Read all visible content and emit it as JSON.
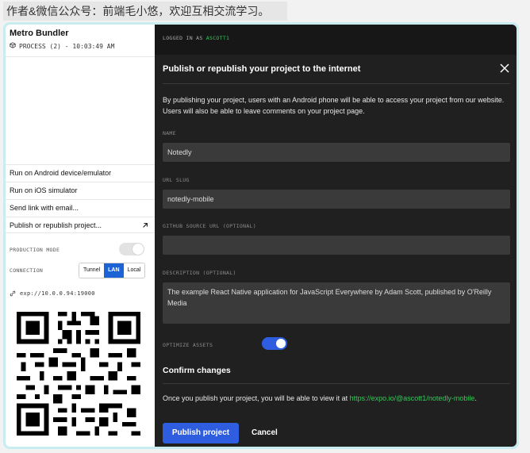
{
  "watermark": "作者&微信公众号：前端毛小悠，欢迎互相交流学习。",
  "sidebar": {
    "title": "Metro Bundler",
    "process": "PROCESS (2) - 10:03:49 AM",
    "menu": [
      {
        "label": "Run on Android device/emulator"
      },
      {
        "label": "Run on iOS simulator"
      },
      {
        "label": "Send link with email..."
      },
      {
        "label": "Publish or republish project..."
      }
    ],
    "production_mode_label": "PRODUCTION MODE",
    "production_mode_on": false,
    "connection_label": "CONNECTION",
    "connection_options": [
      "Tunnel",
      "LAN",
      "Local"
    ],
    "connection_selected": "LAN",
    "exp_url": "exp://10.0.0.94:19000"
  },
  "main": {
    "logged_in_prefix": "LOGGED IN AS",
    "username": "ASCOTT1",
    "dialog_title": "Publish or republish your project to the internet",
    "description": "By publishing your project, users with an Android phone will be able to access your project from our website. Users will also be able to leave comments on your project page.",
    "fields": {
      "name_label": "NAME",
      "name_value": "Notedly",
      "slug_label": "URL SLUG",
      "slug_value": "notedly-mobile",
      "github_label": "GITHUB SOURCE URL (OPTIONAL)",
      "github_value": "",
      "description_label": "DESCRIPTION (OPTIONAL)",
      "description_value": "The example React Native application for JavaScript Everywhere by Adam Scott, published by O'Reilly Media",
      "optimize_label": "OPTIMIZE ASSETS",
      "optimize_on": true
    },
    "confirm_title": "Confirm changes",
    "confirm_text": "Once you publish your project, you will be able to view it at ",
    "confirm_link": "https://expo.io/@ascott1/notedly-mobile",
    "confirm_end": ".",
    "publish_button": "Publish project",
    "cancel_button": "Cancel"
  },
  "colors": {
    "accent": "#2f5de0",
    "link": "#35c759",
    "dialog_bg": "#202020",
    "lan_active": "#1c63d6"
  }
}
